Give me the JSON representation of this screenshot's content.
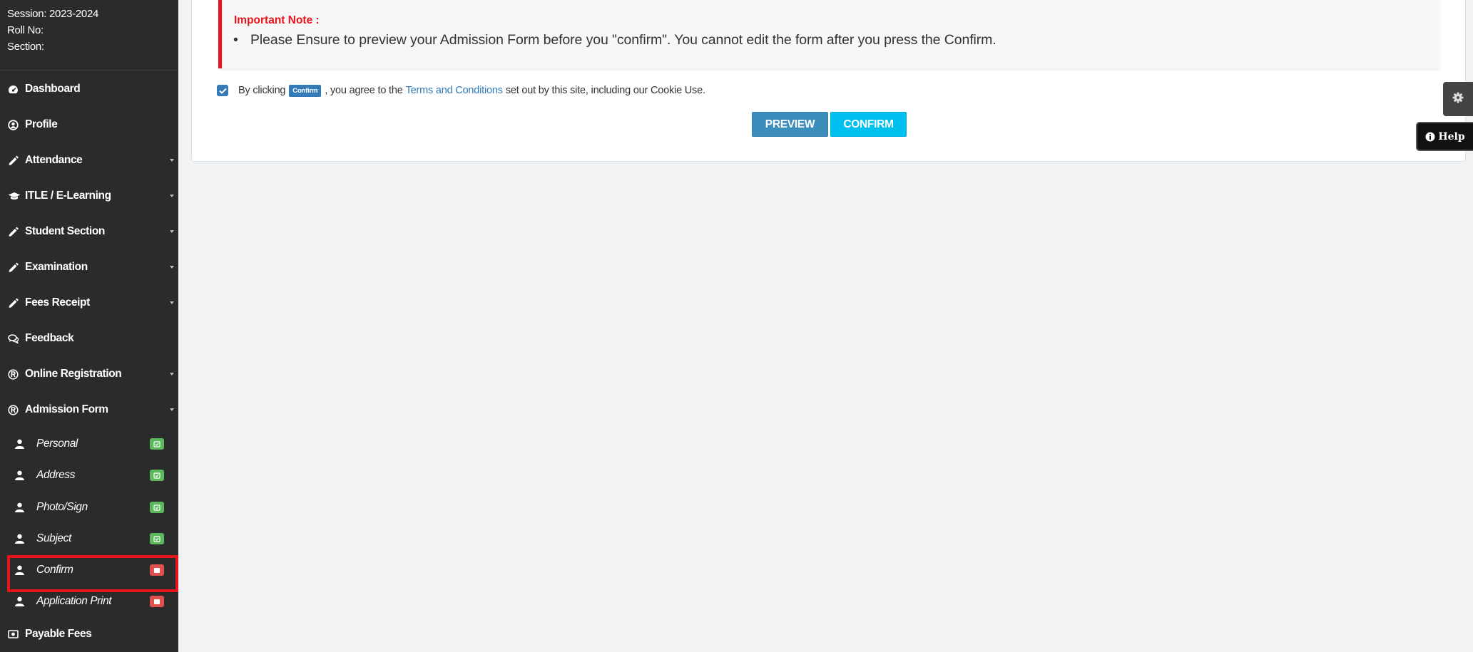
{
  "sidebar": {
    "session": "Session: 2023-2024",
    "roll_no": "Roll No:",
    "section": "Section:",
    "items": [
      {
        "label": "Dashboard",
        "icon": "dashboard-icon"
      },
      {
        "label": "Profile",
        "icon": "user-circle-icon"
      },
      {
        "label": "Attendance",
        "icon": "pencil-icon",
        "has_submenu": true
      },
      {
        "label": "ITLE / E-Learning",
        "icon": "graduation-cap-icon",
        "has_submenu": true
      },
      {
        "label": "Student Section",
        "icon": "pencil-icon",
        "has_submenu": true
      },
      {
        "label": "Examination",
        "icon": "pencil-icon",
        "has_submenu": true
      },
      {
        "label": "Fees Receipt",
        "icon": "pencil-icon",
        "has_submenu": true
      },
      {
        "label": "Feedback",
        "icon": "comments-icon"
      },
      {
        "label": "Online Registration",
        "icon": "registered-icon",
        "has_submenu": true
      },
      {
        "label": "Admission Form",
        "icon": "registered-icon",
        "has_submenu": true
      }
    ],
    "sub_items": [
      {
        "label": "Personal",
        "status": "complete",
        "status_color": "#5cb85c"
      },
      {
        "label": "Address",
        "status": "complete",
        "status_color": "#5cb85c"
      },
      {
        "label": "Photo/Sign",
        "status": "complete",
        "status_color": "#5cb85c"
      },
      {
        "label": "Subject",
        "status": "complete",
        "status_color": "#5cb85c"
      },
      {
        "label": "Confirm",
        "status": "incomplete",
        "status_color": "#e05252"
      },
      {
        "label": "Application Print",
        "status": "incomplete",
        "status_color": "#e05252"
      }
    ],
    "payable_fees": "Payable Fees",
    "highlighted_item": "Confirm"
  },
  "main": {
    "note_title": "Important Note :",
    "note_text": "Please Ensure to preview your Admission Form before you \"confirm\". You cannot edit the form after you press the Confirm.",
    "agree": {
      "checked": true,
      "prefix": "By clicking",
      "badge": "Confirm",
      "middle": ", you agree to the",
      "link": "Terms and Conditions",
      "suffix": "set out by this site, including our Cookie Use."
    },
    "preview_label": "PREVIEW",
    "confirm_label": "CONFIRM"
  },
  "floaters": {
    "help_label": "Help",
    "settings_icon": "gear-icon",
    "help_icon": "info-circle-icon"
  },
  "colors": {
    "sidebar_bg": "#2b2b2b",
    "accent": "#3c8dbc",
    "confirm": "#00c0ef",
    "alert_red": "#e8141c"
  }
}
